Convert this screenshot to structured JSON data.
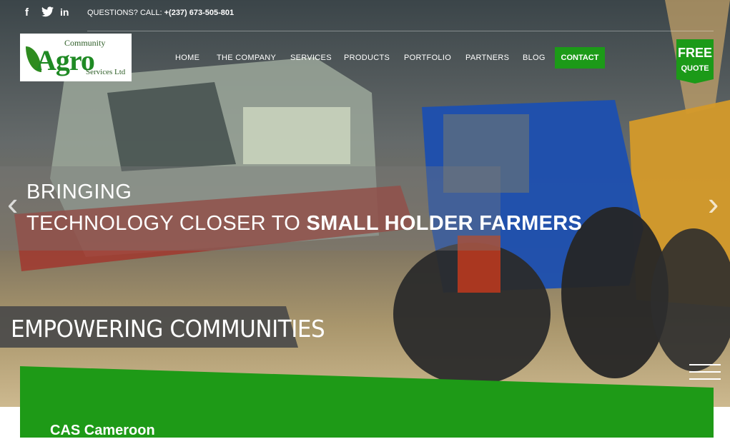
{
  "topbar": {
    "social": [
      {
        "name": "facebook-icon",
        "glyph": "f"
      },
      {
        "name": "twitter-icon",
        "glyph": "🐦"
      },
      {
        "name": "linkedin-icon",
        "glyph": "in"
      }
    ],
    "questions_label": "QUESTIONS? CALL:",
    "phone": "+(237) 673-505-801"
  },
  "logo": {
    "line1": "Community",
    "line2": "Agro",
    "line3": "Services Ltd"
  },
  "nav": {
    "items": [
      {
        "label": "HOME"
      },
      {
        "label": "THE COMPANY"
      },
      {
        "label": "SERVICES"
      },
      {
        "label": "PRODUCTS"
      },
      {
        "label": "PORTFOLIO"
      },
      {
        "label": "PARTNERS"
      },
      {
        "label": "BLOG"
      }
    ],
    "contact": "CONTACT"
  },
  "free_quote": {
    "line1": "FREE",
    "line2": "QUOTE"
  },
  "hero": {
    "line1": "BRINGING",
    "line2_prefix": "TECHNOLOGY CLOSER TO ",
    "line2_bold": "SMALL HOLDER FARMERS",
    "prev_arrow": "‹",
    "next_arrow": "›",
    "banner": "EMPOWERING COMMUNITIES"
  },
  "card": {
    "title": "CAS Cameroon"
  },
  "colors": {
    "accent": "#1c9a18",
    "banner_bg": "#4a4a4a"
  }
}
